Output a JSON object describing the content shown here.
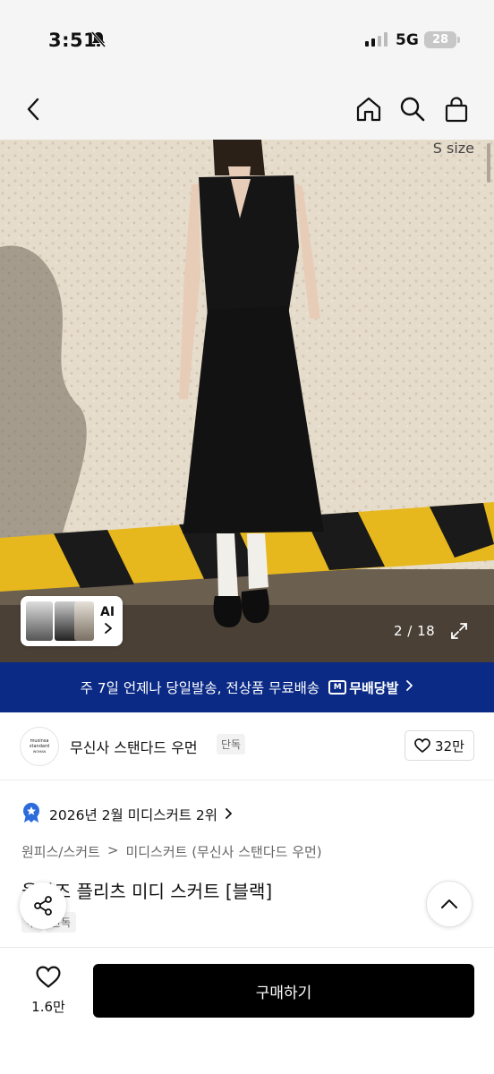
{
  "status_bar": {
    "time": "3:51",
    "network": "5G",
    "battery": "28"
  },
  "hero": {
    "size_label": "S size",
    "counter": "2 / 18",
    "ai_label": "AI"
  },
  "banner": {
    "text": "주 7일 언제나 당일발송, 전상품 무료배송",
    "badge": "무배당발",
    "badge_icon_letter": "M"
  },
  "brand": {
    "logo_lines": [
      "musinsa",
      "standard",
      "WOMAN"
    ],
    "name": "무신사 스탠다드 우먼",
    "tag": "단독",
    "likes": "32만"
  },
  "ranking": {
    "text": "2026년 2월 미디스커트 2위"
  },
  "breadcrumb": [
    "원피스/스커트",
    "미디스커트 (무신사 스탠다드 우먼)"
  ],
  "breadcrumb_separator": ">",
  "product": {
    "title": "울라즈 플리츠 미디 스커트 [블랙]",
    "tags": [
      "무",
      "단독"
    ]
  },
  "bottom_bar": {
    "wish_count": "1.6만",
    "buy_label": "구매하기"
  },
  "colors": {
    "banner_bg": "#0b2a86",
    "buy_bg": "#000000",
    "rank_medal": "#2c6bdb"
  }
}
